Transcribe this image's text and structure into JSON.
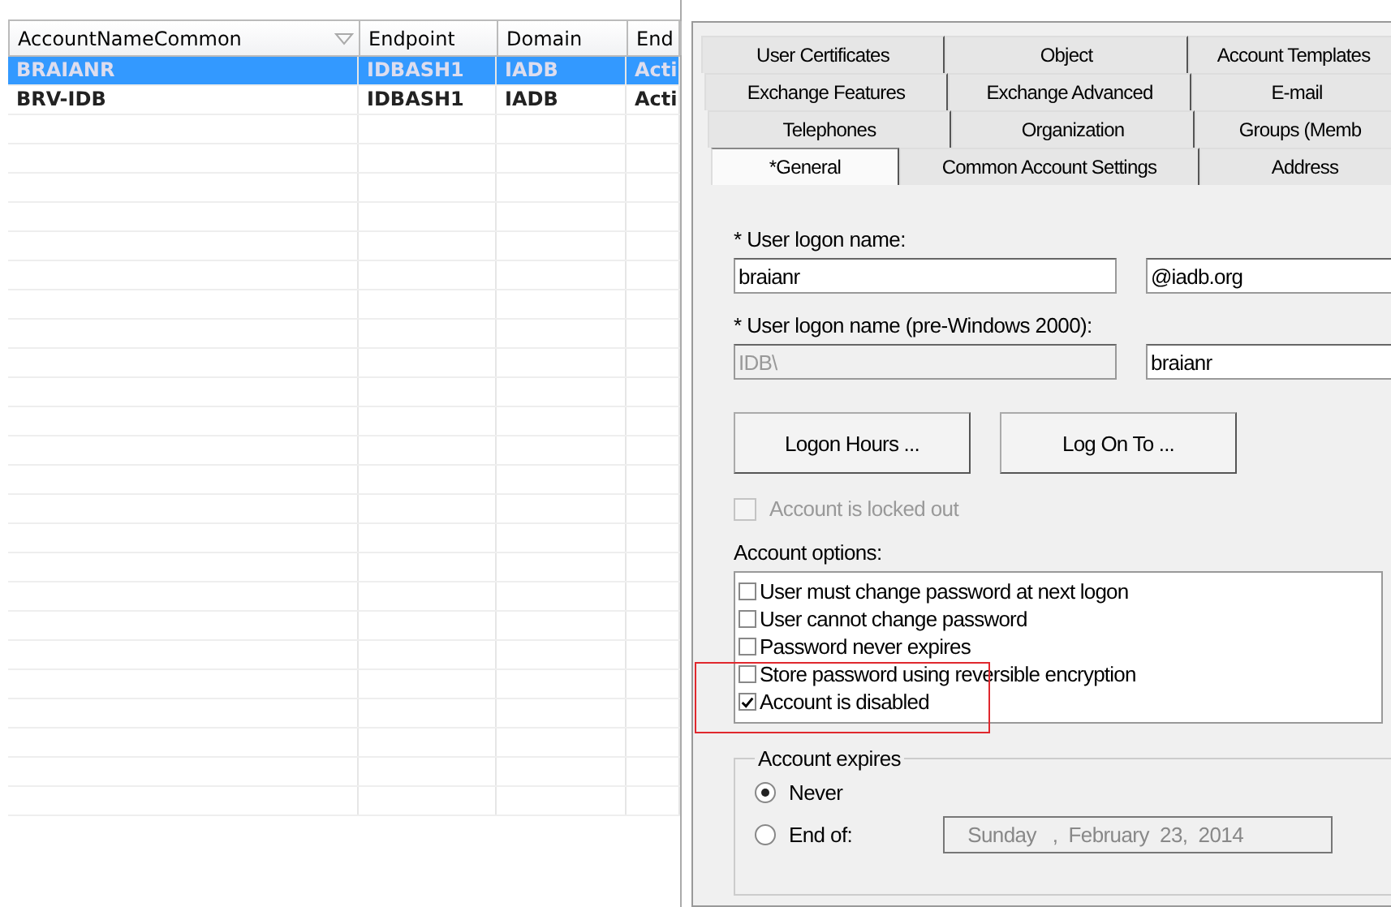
{
  "grid": {
    "columns": [
      {
        "label": "AccountNameCommon",
        "sort_icon": true
      },
      {
        "label": "Endpoint",
        "sort_icon": false
      },
      {
        "label": "Domain",
        "sort_icon": false
      },
      {
        "label": "End",
        "sort_icon": false
      }
    ],
    "rows": [
      {
        "cells": [
          "BRAIANR",
          "IDBASH1",
          "IADB",
          "Acti"
        ],
        "selected": true
      },
      {
        "cells": [
          "BRV-IDB",
          "IDBASH1",
          "IADB",
          "Acti"
        ],
        "selected": false
      }
    ]
  },
  "tab_rows": [
    [
      {
        "label": "User Certificates",
        "selected": false
      },
      {
        "label": "Object",
        "selected": false
      },
      {
        "label": "Account Templates",
        "selected": false
      }
    ],
    [
      {
        "label": "Exchange Features",
        "selected": false
      },
      {
        "label": "Exchange Advanced",
        "selected": false
      },
      {
        "label": "E-mail",
        "selected": false
      }
    ],
    [
      {
        "label": "Telephones",
        "selected": false
      },
      {
        "label": "Organization",
        "selected": false
      },
      {
        "label": "Groups (Memb",
        "selected": false
      }
    ],
    [
      {
        "label": "*General",
        "selected": true
      },
      {
        "label": "Common Account Settings",
        "selected": false
      },
      {
        "label": "Address",
        "selected": false
      }
    ]
  ],
  "logon_name": {
    "label": "* User logon name:",
    "value": "braianr",
    "domain": "@iadb.org"
  },
  "logon_name_pre2000": {
    "label": "* User logon name (pre-Windows 2000):",
    "domain": "IDB\\",
    "value": "braianr"
  },
  "buttons": [
    "Logon Hours ...",
    "Log On To ..."
  ],
  "locked_out": {
    "label": "Account is locked out",
    "checked": false,
    "disabled": true
  },
  "account_options": {
    "label": "Account options:",
    "items": [
      {
        "label": "User must change password at next logon",
        "checked": false
      },
      {
        "label": "User cannot change password",
        "checked": false
      },
      {
        "label": "Password never expires",
        "checked": false
      },
      {
        "label": "Store password using reversible encryption",
        "checked": false
      },
      {
        "label": "Account is disabled",
        "checked": true
      }
    ],
    "highlight": true
  },
  "account_expires": {
    "label": "Account expires",
    "options": [
      {
        "label": "Never",
        "selected": true
      },
      {
        "label": "End of:",
        "selected": false
      }
    ],
    "date": "Sunday   ,  February  23,  2014"
  }
}
